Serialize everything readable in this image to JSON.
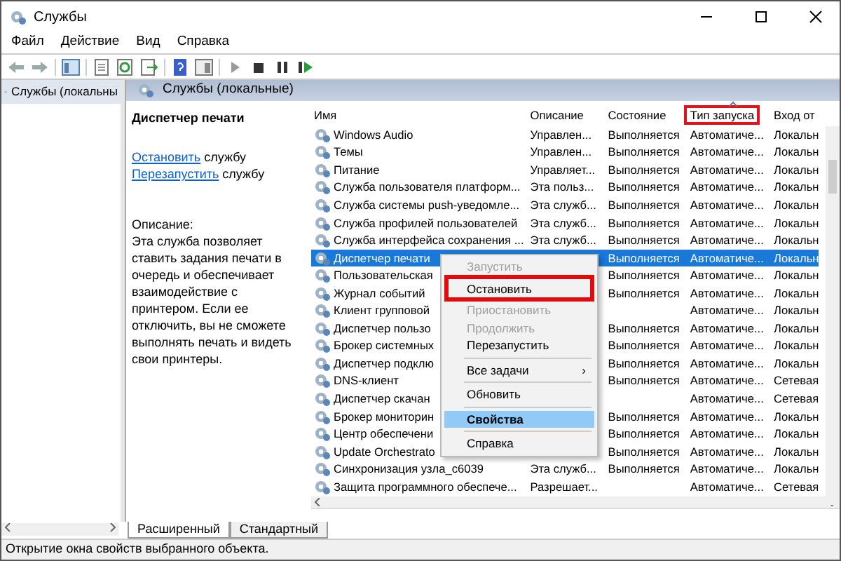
{
  "window": {
    "title": "Службы"
  },
  "menu_bar": [
    "Файл",
    "Действие",
    "Вид",
    "Справка"
  ],
  "tree": [
    {
      "label": "Службы (локальны",
      "selected": true
    }
  ],
  "panel_header": "Службы (локальные)",
  "details": {
    "title": "Диспетчер печати",
    "actions": [
      {
        "link": "Остановить",
        "text": "службу"
      },
      {
        "link": "Перезапустить",
        "text": "службу"
      }
    ],
    "description_label": "Описание:",
    "description": "Эта служба позволяет ставить задания печати в очередь и обеспечивает взаимодействие с принтером. Если ее отключить, вы не сможете выполнять печать и видеть свои принтеры."
  },
  "table": {
    "columns": [
      {
        "label": "Имя",
        "sorted": false,
        "annotated": false
      },
      {
        "label": "Описание",
        "sorted": false,
        "annotated": false
      },
      {
        "label": "Состояние",
        "sorted": false,
        "annotated": false
      },
      {
        "label": "Тип запуска",
        "sorted": true,
        "annotated": true
      },
      {
        "label": "Вход от",
        "sorted": false,
        "annotated": false
      }
    ],
    "rows": [
      {
        "name": "Windows Audio",
        "description": "Управлен...",
        "state": "Выполняется",
        "startup": "Автоматиче...",
        "logon": "Локальн",
        "selected": false
      },
      {
        "name": "Темы",
        "description": "Управлен...",
        "state": "Выполняется",
        "startup": "Автоматиче...",
        "logon": "Локальн",
        "selected": false
      },
      {
        "name": "Питание",
        "description": "Управляет...",
        "state": "Выполняется",
        "startup": "Автоматиче...",
        "logon": "Локальн",
        "selected": false
      },
      {
        "name": "Служба пользователя платформ...",
        "description": "Эта польз...",
        "state": "Выполняется",
        "startup": "Автоматиче...",
        "logon": "Локальн",
        "selected": false
      },
      {
        "name": "Служба системы push-уведомле...",
        "description": "Эта служб...",
        "state": "Выполняется",
        "startup": "Автоматиче...",
        "logon": "Локальн",
        "selected": false
      },
      {
        "name": "Служба профилей пользователей",
        "description": "Эта служб...",
        "state": "Выполняется",
        "startup": "Автоматиче...",
        "logon": "Локальн",
        "selected": false
      },
      {
        "name": "Служба интерфейса сохранения ...",
        "description": "Эта служб...",
        "state": "Выполняется",
        "startup": "Автоматиче...",
        "logon": "Локальн",
        "selected": false
      },
      {
        "name": "Диспетчер печати",
        "state": "Выполняется",
        "startup": "Автоматиче...",
        "logon": "Локальн",
        "selected": true
      },
      {
        "name": "Пользовательская",
        "state": "Выполняется",
        "startup": "Автоматиче...",
        "logon": "Локальн",
        "selected": false
      },
      {
        "name": "Журнал событий",
        "state": "Выполняется",
        "startup": "Автоматиче...",
        "logon": "Локальн",
        "selected": false
      },
      {
        "name": "Клиент групповой",
        "startup": "Автоматиче...",
        "logon": "Локальн",
        "selected": false
      },
      {
        "name": "Диспетчер пользо",
        "state": "Выполняется",
        "startup": "Автоматиче...",
        "logon": "Локальн",
        "selected": false
      },
      {
        "name": "Брокер системных",
        "state": "Выполняется",
        "startup": "Автоматиче...",
        "logon": "Локальн",
        "selected": false
      },
      {
        "name": "Диспетчер подклю",
        "state": "Выполняется",
        "startup": "Автоматиче...",
        "logon": "Локальн",
        "selected": false
      },
      {
        "name": "DNS-клиент",
        "state": "Выполняется",
        "startup": "Автоматиче...",
        "logon": "Сетевая",
        "selected": false
      },
      {
        "name": "Диспетчер скачан",
        "startup": "Автоматиче...",
        "logon": "Сетевая",
        "selected": false
      },
      {
        "name": "Брокер мониторин",
        "state": "Выполняется",
        "startup": "Автоматиче...",
        "logon": "Локальн",
        "selected": false
      },
      {
        "name": "Центр обеспечени",
        "state": "Выполняется",
        "startup": "Автоматиче...",
        "logon": "Локальн",
        "selected": false
      },
      {
        "name": "Update Orchestrato",
        "state": "Выполняется",
        "startup": "Автоматиче...",
        "logon": "Локальн",
        "selected": false
      },
      {
        "name": "Синхронизация узла_c6039",
        "description": "Эта служб...",
        "state": "Выполняется",
        "startup": "Автоматиче...",
        "logon": "Локальн",
        "selected": false
      },
      {
        "name": "Защита программного обеспече...",
        "description": "Разрешает...",
        "startup": "Автоматиче...",
        "logon": "Сетевая",
        "selected": false
      }
    ]
  },
  "context_menu": {
    "items": [
      {
        "kind": "item",
        "label": "Запустить",
        "disabled": true,
        "selected": false,
        "annotated": false,
        "bold": false
      },
      {
        "kind": "item",
        "label": "Остановить",
        "disabled": false,
        "selected": false,
        "annotated": true,
        "bold": false
      },
      {
        "kind": "item",
        "label": "Приостановить",
        "disabled": true,
        "selected": false,
        "annotated": false,
        "bold": false
      },
      {
        "kind": "item",
        "label": "Продолжить",
        "disabled": true,
        "selected": false,
        "annotated": false,
        "bold": false
      },
      {
        "kind": "item",
        "label": "Перезапустить",
        "disabled": false,
        "selected": false,
        "annotated": false,
        "bold": false
      },
      {
        "kind": "separator"
      },
      {
        "kind": "submenu",
        "label": "Все задачи",
        "arrow": "›",
        "disabled": false,
        "selected": false,
        "annotated": false,
        "bold": false
      },
      {
        "kind": "separator"
      },
      {
        "kind": "item",
        "label": "Обновить",
        "disabled": false,
        "selected": false,
        "annotated": false,
        "bold": false
      },
      {
        "kind": "separator"
      },
      {
        "kind": "item",
        "label": "Свойства",
        "disabled": false,
        "selected": true,
        "annotated": false,
        "bold": true
      },
      {
        "kind": "separator"
      },
      {
        "kind": "item",
        "label": "Справка",
        "disabled": false,
        "selected": false,
        "annotated": false,
        "bold": false
      }
    ]
  },
  "tabs": [
    {
      "label": "Расширенный",
      "selected": true
    },
    {
      "label": "Стандартный",
      "selected": false
    }
  ],
  "status_bar": "Открытие окна свойств выбранного объекта."
}
